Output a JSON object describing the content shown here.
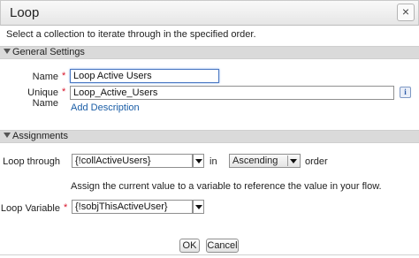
{
  "dialog": {
    "title": "Loop",
    "close_glyph": "×",
    "description": "Select a collection to iterate through in the specified order."
  },
  "general": {
    "section_label": "General Settings",
    "name_label": "Name",
    "name_value": "Loop Active Users",
    "unique_name_label": "Unique Name",
    "unique_name_value": "Loop_Active_Users",
    "info_glyph": "i",
    "add_description": "Add Description",
    "required_glyph": "*"
  },
  "assignments": {
    "section_label": "Assignments",
    "loop_through_label": "Loop through",
    "loop_through_value": "{!collActiveUsers}",
    "in_text": "in",
    "order_value": "Ascending",
    "order_text": "order",
    "assign_hint": "Assign the current value to a variable to reference the value in your flow.",
    "loop_variable_label": "Loop Variable",
    "loop_variable_value": "{!sobjThisActiveUser}"
  },
  "footer": {
    "ok_label": "OK",
    "cancel_label": "Cancel"
  }
}
